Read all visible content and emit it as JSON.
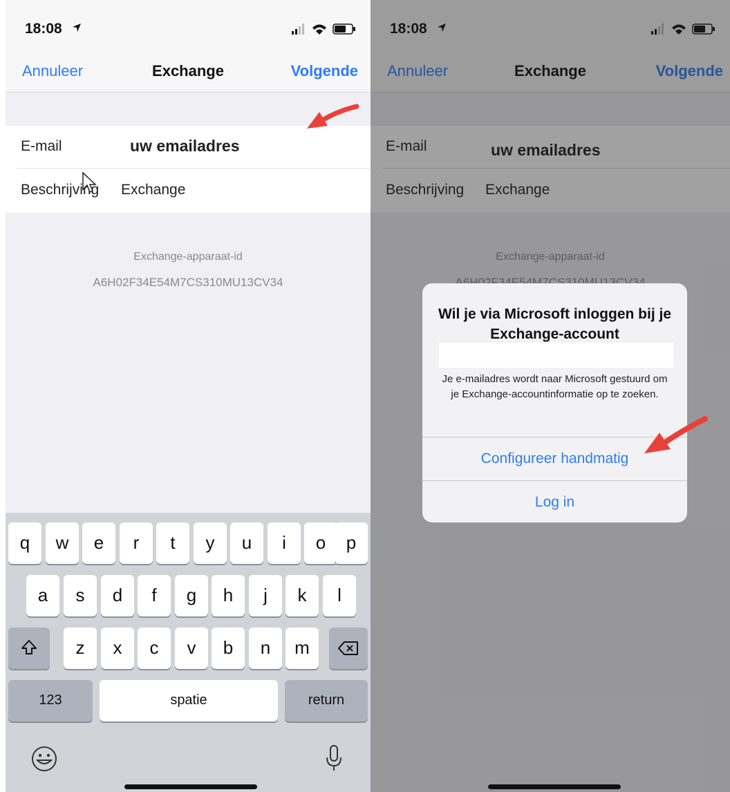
{
  "left": {
    "status": {
      "time": "18:08"
    },
    "nav": {
      "cancel": "Annuleer",
      "title": "Exchange",
      "next": "Volgende"
    },
    "form": {
      "email_label": "E-mail",
      "email_value": "uw emailadres",
      "desc_label": "Beschrijving",
      "desc_value": "Exchange"
    },
    "device": {
      "label": "Exchange-apparaat-id",
      "value": "A6H02F34E54M7CS310MU13CV34"
    },
    "keyboard": {
      "row1": [
        "q",
        "w",
        "e",
        "r",
        "t",
        "y",
        "u",
        "i",
        "o",
        "p"
      ],
      "row2": [
        "a",
        "s",
        "d",
        "f",
        "g",
        "h",
        "j",
        "k",
        "l"
      ],
      "row3": [
        "z",
        "x",
        "c",
        "v",
        "b",
        "n",
        "m"
      ],
      "numbers": "123",
      "space": "spatie",
      "return": "return"
    }
  },
  "right": {
    "status": {
      "time": "18:08"
    },
    "nav": {
      "cancel": "Annuleer",
      "title": "Exchange",
      "next": "Volgende"
    },
    "form": {
      "email_label": "E-mail",
      "email_value": "uw emailadres",
      "desc_label": "Beschrijving",
      "desc_value": "Exchange"
    },
    "device": {
      "label": "Exchange-apparaat-id",
      "value": "A6H02F34E54M7CS310MU13CV34"
    },
    "alert": {
      "title": "Wil je via Microsoft inloggen bij je Exchange-account",
      "message": "Je e-mailadres wordt naar Microsoft gestuurd om je Exchange-accountinformatie op te zoeken.",
      "manual": "Configureer handmatig",
      "login": "Log in"
    }
  },
  "colors": {
    "accent": "#2f7cf6",
    "arrow": "#e8413a"
  }
}
